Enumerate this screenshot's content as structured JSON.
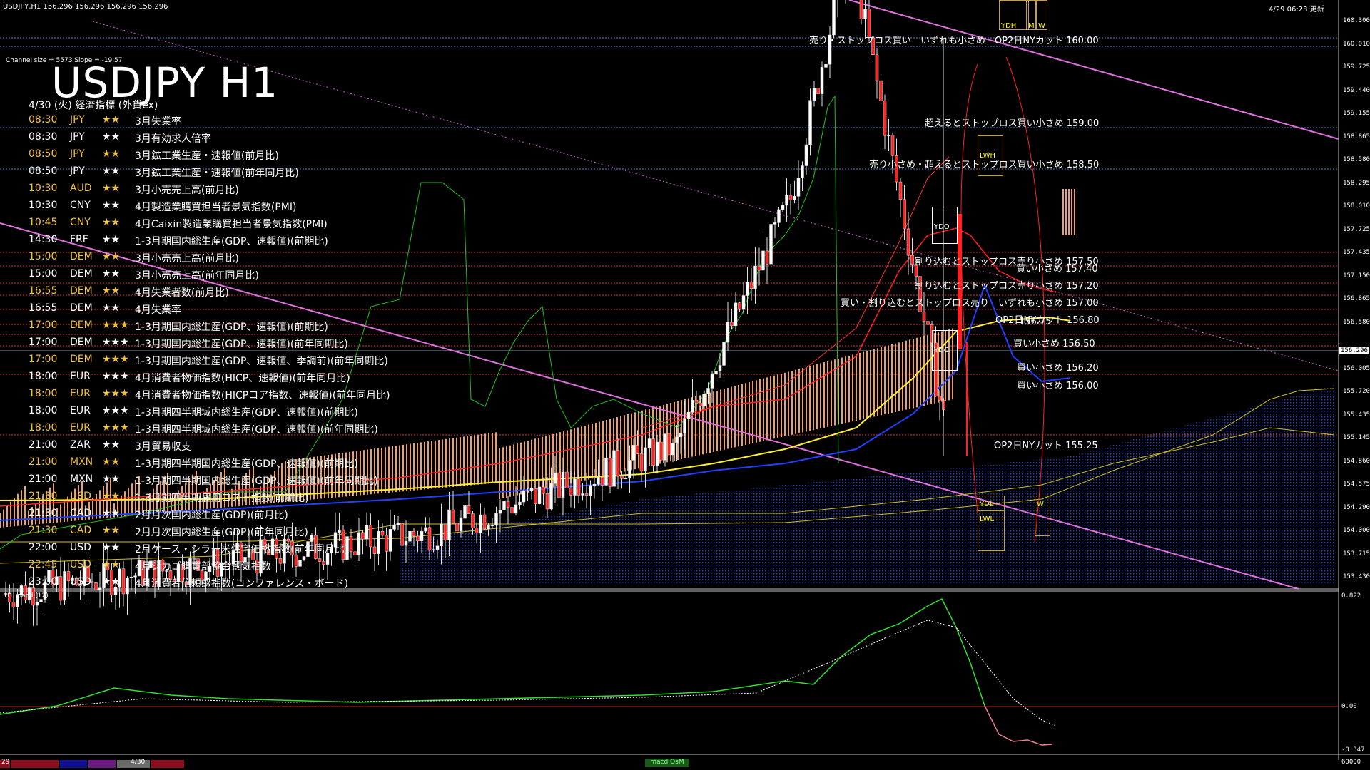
{
  "header": {
    "symbol_info": "USDJPY,H1  156.296 156.296 156.296 156.296",
    "datetime": "4/29 06:23 更新",
    "channel_info": "Channel size = 5573 Slope = -19.57"
  },
  "title": "USDJPY H1",
  "subtitle": "4/30 (火) 経済指標 (外貨ex)",
  "events": [
    {
      "time": "08:30",
      "cur": "JPY",
      "stars": "★★",
      "name": "3月失業率"
    },
    {
      "time": "08:30",
      "cur": "JPY",
      "stars": "★★",
      "name": "3月有効求人倍率"
    },
    {
      "time": "08:50",
      "cur": "JPY",
      "stars": "★★",
      "name": "3月鉱工業生産・速報値(前月比)"
    },
    {
      "time": "08:50",
      "cur": "JPY",
      "stars": "★★",
      "name": "3月鉱工業生産・速報値(前年同月比)"
    },
    {
      "time": "10:30",
      "cur": "AUD",
      "stars": "★★",
      "name": "3月小売売上高(前月比)"
    },
    {
      "time": "10:30",
      "cur": "CNY",
      "stars": "★★",
      "name": "4月製造業購買担当者景気指数(PMI)"
    },
    {
      "time": "10:45",
      "cur": "CNY",
      "stars": "★★",
      "name": "4月Caixin製造業購買担当者景気指数(PMI)"
    },
    {
      "time": "14:30",
      "cur": "FRF",
      "stars": "★★",
      "name": "1-3月期国内総生産(GDP、速報値)(前期比)"
    },
    {
      "time": "15:00",
      "cur": "DEM",
      "stars": "★★",
      "name": "3月小売売上高(前月比)"
    },
    {
      "time": "15:00",
      "cur": "DEM",
      "stars": "★★",
      "name": "3月小売売上高(前年同月比)"
    },
    {
      "time": "16:55",
      "cur": "DEM",
      "stars": "★★",
      "name": "4月失業者数(前月比)"
    },
    {
      "time": "16:55",
      "cur": "DEM",
      "stars": "★★",
      "name": "4月失業率"
    },
    {
      "time": "17:00",
      "cur": "DEM",
      "stars": "★★★",
      "name": "1-3月期国内総生産(GDP、速報値)(前期比)"
    },
    {
      "time": "17:00",
      "cur": "DEM",
      "stars": "★★★",
      "name": "1-3月期国内総生産(GDP、速報値)(前年同期比)"
    },
    {
      "time": "17:00",
      "cur": "DEM",
      "stars": "★★★",
      "name": "1-3月期国内総生産(GDP、速報値、季調前)(前年同期比)"
    },
    {
      "time": "18:00",
      "cur": "EUR",
      "stars": "★★★",
      "name": "4月消費者物価指数(HICP、速報値)(前年同月比)"
    },
    {
      "time": "18:00",
      "cur": "EUR",
      "stars": "★★★",
      "name": "4月消費者物価指数(HICPコア指数、速報値)(前年同月比)"
    },
    {
      "time": "18:00",
      "cur": "EUR",
      "stars": "★★★",
      "name": "1-3月期四半期域内総生産(GDP、速報値)(前期比)"
    },
    {
      "time": "18:00",
      "cur": "EUR",
      "stars": "★★★",
      "name": "1-3月期四半期域内総生産(GDP、速報値)(前年同期比)"
    },
    {
      "time": "21:00",
      "cur": "ZAR",
      "stars": "★★",
      "name": "3月貿易収支"
    },
    {
      "time": "21:00",
      "cur": "MXN",
      "stars": "★★",
      "name": "1-3月期四半期国内総生産(GDP、速報値)(前期比)"
    },
    {
      "time": "21:00",
      "cur": "MXN",
      "stars": "★★",
      "name": "1-3月期四半期国内総生産(GDP、速報値)(前年同期比)"
    },
    {
      "time": "21:30",
      "cur": "USD",
      "stars": "★★",
      "name": "1-3月期四半期雇用コスト指数(前期比)"
    },
    {
      "time": "21:30",
      "cur": "CAD",
      "stars": "★★",
      "name": "2月月次国内総生産(GDP)(前月比)"
    },
    {
      "time": "21:30",
      "cur": "CAD",
      "stars": "★★",
      "name": "2月月次国内総生産(GDP)(前年同月比)"
    },
    {
      "time": "22:00",
      "cur": "USD",
      "stars": "★★",
      "name": "2月ケース・シラー米住宅価格指数(前年同月比)"
    },
    {
      "time": "22:45",
      "cur": "USD",
      "stars": "★★",
      "name": "4月シカゴ購買部協会景気指数"
    },
    {
      "time": "23:00",
      "cur": "USD",
      "stars": "★★",
      "name": "4月消費者信頼感指数(コンファレンス・ボード)"
    }
  ],
  "price_axis": {
    "labels": [
      "160.300",
      "160.010",
      "159.725",
      "159.440",
      "159.155",
      "158.865",
      "158.580",
      "158.295",
      "158.010",
      "157.725",
      "157.435",
      "157.150",
      "156.865",
      "156.580",
      "156.296",
      "156.005",
      "155.720",
      "155.435",
      "155.145",
      "154.860",
      "154.575",
      "154.290",
      "154.000",
      "153.715",
      "153.430"
    ],
    "current": "156.296"
  },
  "levels": [
    {
      "text": "売り・ストップロス買い　いずれも小さめ　OP2日NYカット 160.00"
    },
    {
      "text": "超えるとストップロス買い小さめ 159.00"
    },
    {
      "text": "売り小さめ・超えるとストップロス買い小さめ 158.50"
    },
    {
      "text": "割り込むとストップロス売り小さめ 157.50"
    },
    {
      "text": "買い小さめ 157.40"
    },
    {
      "text": "割り込むとストップロス売り小さめ 157.20"
    },
    {
      "text": "買い・割り込むとストップロス売り　いずれも小さめ 157.00"
    },
    {
      "text": "OP2日NYカット 156.80"
    },
    {
      "text": "156.75"
    },
    {
      "text": "買い小さめ 156.50"
    },
    {
      "text": "買い小さめ 156.20"
    },
    {
      "text": "買い小さめ 156.00"
    },
    {
      "text": "OP2日NYカット 155.25"
    }
  ],
  "boxes": [
    "YDH",
    "M",
    "W",
    "LWH",
    "YDO",
    "YDC",
    "YDL",
    "LWL",
    "W"
  ],
  "macd": {
    "label": "H1 macd (12)",
    "axis": [
      "0.822",
      "0.00",
      "-0.347"
    ]
  },
  "bottom": {
    "date_left": "29",
    "date_mid": "4/30",
    "tab_text": "macd OsM",
    "right_val": "60000"
  }
}
